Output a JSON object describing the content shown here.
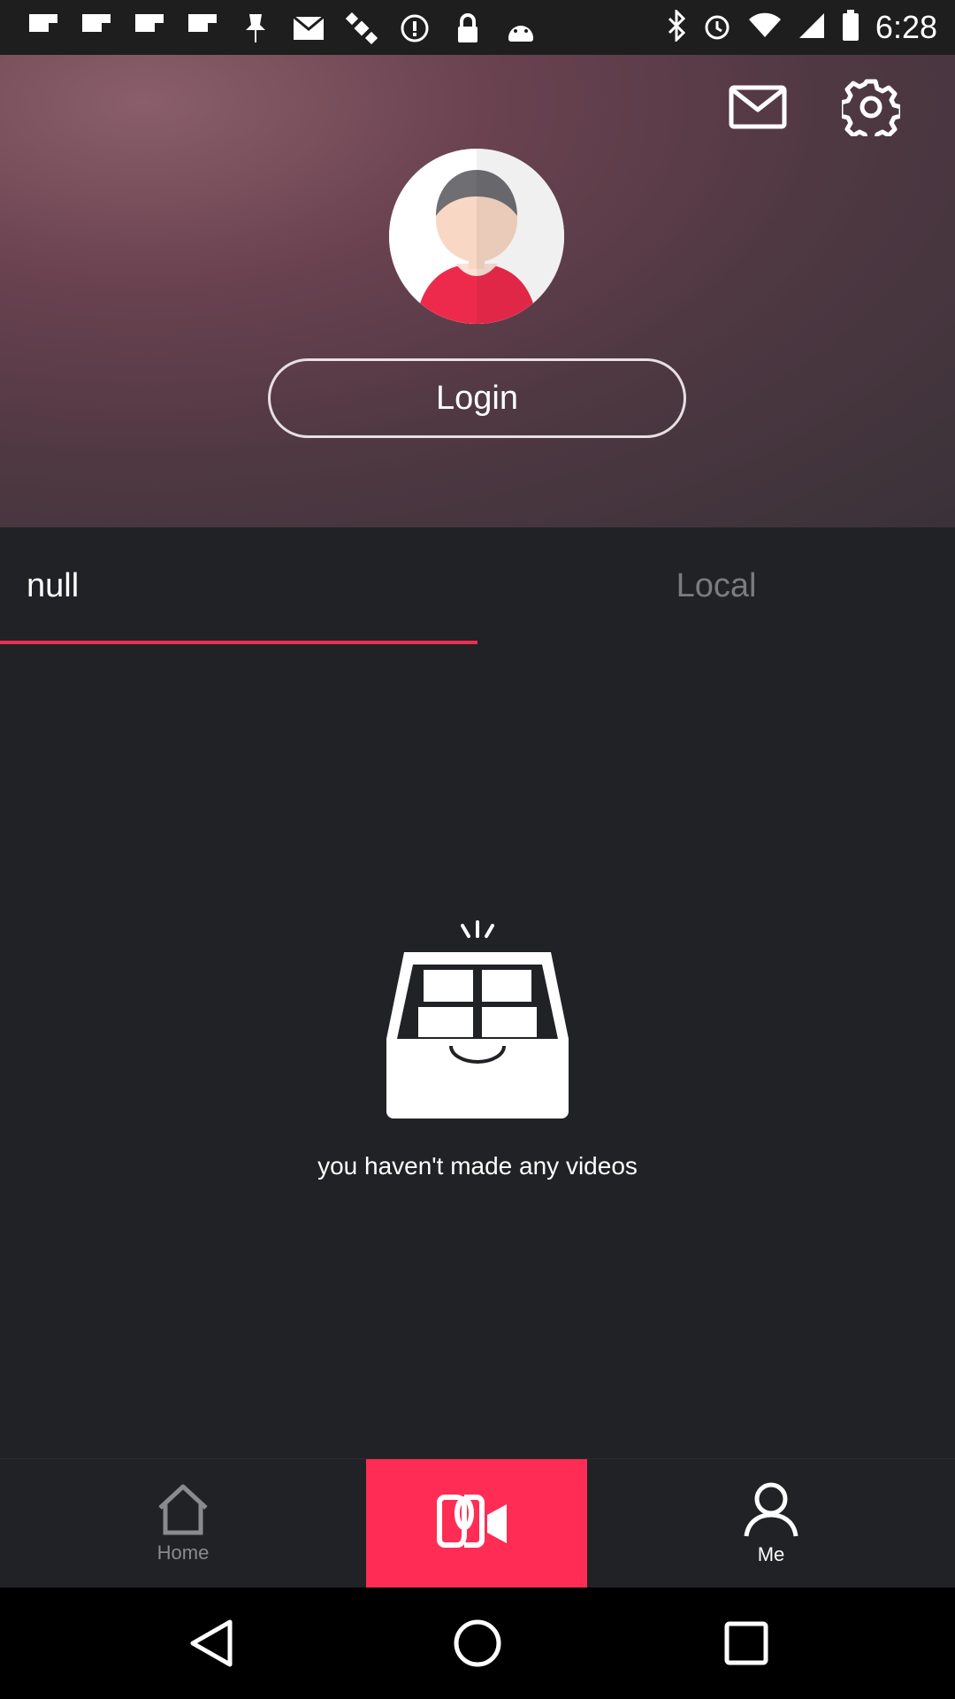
{
  "status_bar": {
    "time": "6:28",
    "left_icons": [
      "flipboard-icon",
      "flipboard-icon",
      "flipboard-icon",
      "flipboard-icon",
      "pin-icon",
      "mail-notification-icon",
      "satellite-icon",
      "info-icon",
      "lock-icon",
      "android-icon"
    ],
    "right_icons": [
      "bluetooth-icon",
      "alarm-icon",
      "wifi-icon",
      "signal-icon",
      "battery-icon"
    ]
  },
  "header": {
    "login_label": "Login"
  },
  "tabs": [
    {
      "label": "null",
      "active": true
    },
    {
      "label": "Local",
      "active": false
    }
  ],
  "empty_state": {
    "message": "you haven't made any videos"
  },
  "bottom_nav": {
    "home_label": "Home",
    "me_label": "Me",
    "accent_color": "#ff2d55"
  },
  "colors": {
    "background": "#212225",
    "tab_indicator": "#ef2c55",
    "inactive_text": "#7b7b80"
  }
}
